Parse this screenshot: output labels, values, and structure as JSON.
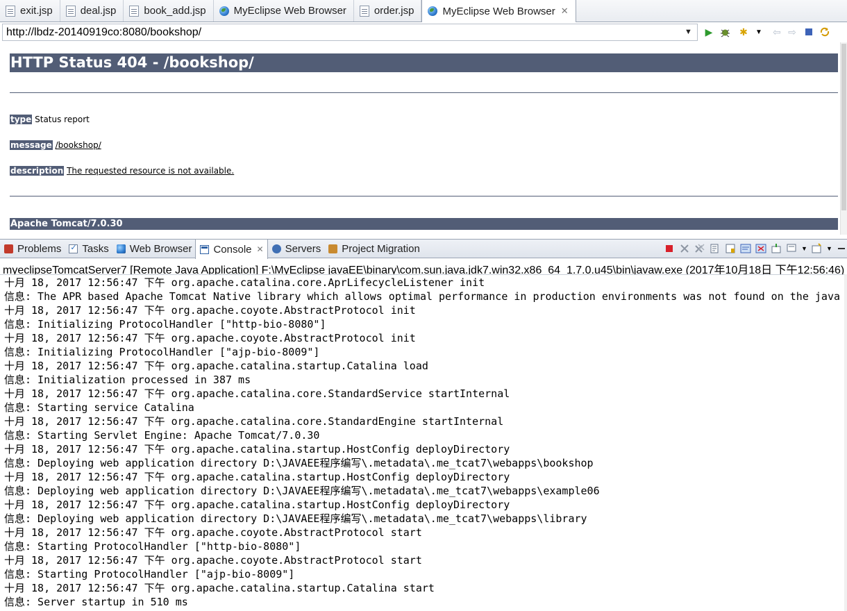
{
  "editor_tabs": [
    {
      "label": "exit.jsp",
      "icon": "jsp-file-icon"
    },
    {
      "label": "deal.jsp",
      "icon": "jsp-file-icon"
    },
    {
      "label": "book_add.jsp",
      "icon": "jsp-file-icon"
    },
    {
      "label": "MyEclipse Web Browser",
      "icon": "globe-icon"
    },
    {
      "label": "order.jsp",
      "icon": "jsp-file-icon"
    },
    {
      "label": "MyEclipse Web Browser",
      "icon": "globe-icon",
      "active": true,
      "close": "✕"
    }
  ],
  "browser": {
    "url": "http://lbdz-20140919co:8080/bookshop/"
  },
  "page": {
    "heading": "HTTP Status 404 - /bookshop/",
    "type_label": "type",
    "type_value": "Status report",
    "message_label": "message",
    "message_value": "/bookshop/",
    "description_label": "description",
    "description_value": "The requested resource is not available.",
    "footer": "Apache Tomcat/7.0.30",
    "colors": {
      "bar": "#525d76"
    }
  },
  "view_tabs": [
    {
      "label": "Problems",
      "icon": "problems-icon"
    },
    {
      "label": "Tasks",
      "icon": "tasks-icon"
    },
    {
      "label": "Web Browser",
      "icon": "web-browser-icon"
    },
    {
      "label": "Console",
      "icon": "console-icon",
      "active": true,
      "close": "✕"
    },
    {
      "label": "Servers",
      "icon": "servers-icon"
    },
    {
      "label": "Project Migration",
      "icon": "project-migration-icon"
    }
  ],
  "console": {
    "header": "myeclipseTomcatServer7 [Remote Java Application] F:\\MyEclipse  javaEE\\binary\\com.sun.java.jdk7.win32.x86_64_1.7.0.u45\\bin\\javaw.exe (2017年10月18日 下午12:56:46)",
    "lines": [
      "十月 18, 2017 12:56:47 下午 org.apache.catalina.core.AprLifecycleListener init",
      "信息: The APR based Apache Tomcat Native library which allows optimal performance in production environments was not found on the java",
      "十月 18, 2017 12:56:47 下午 org.apache.coyote.AbstractProtocol init",
      "信息: Initializing ProtocolHandler [\"http-bio-8080\"]",
      "十月 18, 2017 12:56:47 下午 org.apache.coyote.AbstractProtocol init",
      "信息: Initializing ProtocolHandler [\"ajp-bio-8009\"]",
      "十月 18, 2017 12:56:47 下午 org.apache.catalina.startup.Catalina load",
      "信息: Initialization processed in 387 ms",
      "十月 18, 2017 12:56:47 下午 org.apache.catalina.core.StandardService startInternal",
      "信息: Starting service Catalina",
      "十月 18, 2017 12:56:47 下午 org.apache.catalina.core.StandardEngine startInternal",
      "信息: Starting Servlet Engine: Apache Tomcat/7.0.30",
      "十月 18, 2017 12:56:47 下午 org.apache.catalina.startup.HostConfig deployDirectory",
      "信息: Deploying web application directory D:\\JAVAEE程序编写\\.metadata\\.me_tcat7\\webapps\\bookshop",
      "十月 18, 2017 12:56:47 下午 org.apache.catalina.startup.HostConfig deployDirectory",
      "信息: Deploying web application directory D:\\JAVAEE程序编写\\.metadata\\.me_tcat7\\webapps\\example06",
      "十月 18, 2017 12:56:47 下午 org.apache.catalina.startup.HostConfig deployDirectory",
      "信息: Deploying web application directory D:\\JAVAEE程序编写\\.metadata\\.me_tcat7\\webapps\\library",
      "十月 18, 2017 12:56:47 下午 org.apache.coyote.AbstractProtocol start",
      "信息: Starting ProtocolHandler [\"http-bio-8080\"]",
      "十月 18, 2017 12:56:47 下午 org.apache.coyote.AbstractProtocol start",
      "信息: Starting ProtocolHandler [\"ajp-bio-8009\"]",
      "十月 18, 2017 12:56:47 下午 org.apache.catalina.startup.Catalina start",
      "信息: Server startup in 510 ms"
    ],
    "line_color": "#000000"
  }
}
